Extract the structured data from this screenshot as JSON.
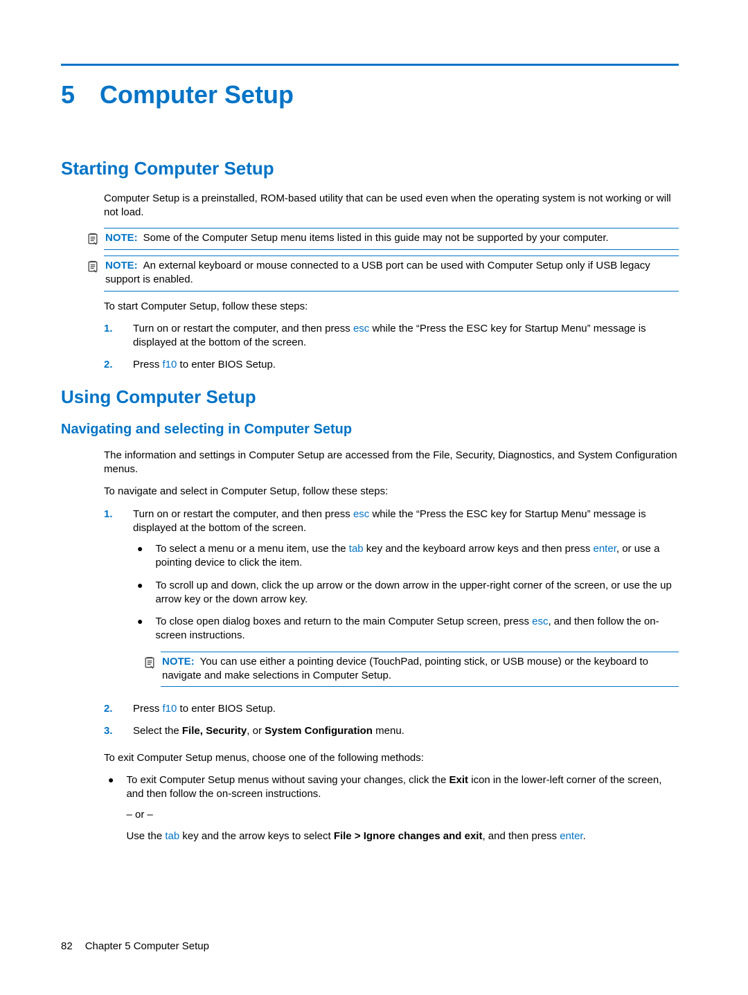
{
  "chapter": {
    "num": "5",
    "title": "Computer Setup"
  },
  "s1": {
    "heading": "Starting Computer Setup",
    "intro": "Computer Setup is a preinstalled, ROM-based utility that can be used even when the operating system is not working or will not load.",
    "note1_label": "NOTE:",
    "note1": "Some of the Computer Setup menu items listed in this guide may not be supported by your computer.",
    "note2_label": "NOTE:",
    "note2": "An external keyboard or mouse connected to a USB port can be used with Computer Setup only if USB legacy support is enabled.",
    "lead": "To start Computer Setup, follow these steps:",
    "step1_a": "Turn on or restart the computer, and then press ",
    "step1_key": "esc",
    "step1_b": " while the “Press the ESC key for Startup Menu” message is displayed at the bottom of the screen.",
    "step2_a": "Press ",
    "step2_key": "f10",
    "step2_b": " to enter BIOS Setup."
  },
  "s2": {
    "heading": "Using Computer Setup",
    "sub": "Navigating and selecting in Computer Setup",
    "p1": "The information and settings in Computer Setup are accessed from the File, Security, Diagnostics, and System Configuration menus.",
    "p2": "To navigate and select in Computer Setup, follow these steps:",
    "st1_a": "Turn on or restart the computer, and then press ",
    "st1_key": "esc",
    "st1_b": " while the “Press the ESC key for Startup Menu” message is displayed at the bottom of the screen.",
    "b1_a": "To select a menu or a menu item, use the ",
    "b1_key1": "tab",
    "b1_b": " key and the keyboard arrow keys and then press ",
    "b1_key2": "enter",
    "b1_c": ", or use a pointing device to click the item.",
    "b2": "To scroll up and down, click the up arrow or the down arrow in the upper-right corner of the screen, or use the up arrow key or the down arrow key.",
    "b3_a": "To close open dialog boxes and return to the main Computer Setup screen, press ",
    "b3_key": "esc",
    "b3_b": ", and then follow the on-screen instructions.",
    "note3_label": "NOTE:",
    "note3": "You can use either a pointing device (TouchPad, pointing stick, or USB mouse) or the keyboard to navigate and make selections in Computer Setup.",
    "st2_a": "Press ",
    "st2_key": "f10",
    "st2_b": " to enter BIOS Setup.",
    "st3_a": "Select the ",
    "st3_bold": "File, Security",
    "st3_mid": ", or ",
    "st3_bold2": "System Configuration",
    "st3_b": " menu.",
    "p3": "To exit Computer Setup menus, choose one of the following methods:",
    "exit_b1_a": "To exit Computer Setup menus without saving your changes, click the ",
    "exit_b1_bold": "Exit",
    "exit_b1_b": " icon in the lower-left corner of the screen, and then follow the on-screen instructions.",
    "or": "– or –",
    "exit_b1_c1": "Use the ",
    "exit_b1_key1": "tab",
    "exit_b1_c2": " key and the arrow keys to select ",
    "exit_b1_bold2": "File > Ignore changes and exit",
    "exit_b1_c3": ", and then press ",
    "exit_b1_key2": "enter",
    "exit_b1_c4": "."
  },
  "footer": {
    "page": "82",
    "text": "Chapter 5   Computer Setup"
  }
}
